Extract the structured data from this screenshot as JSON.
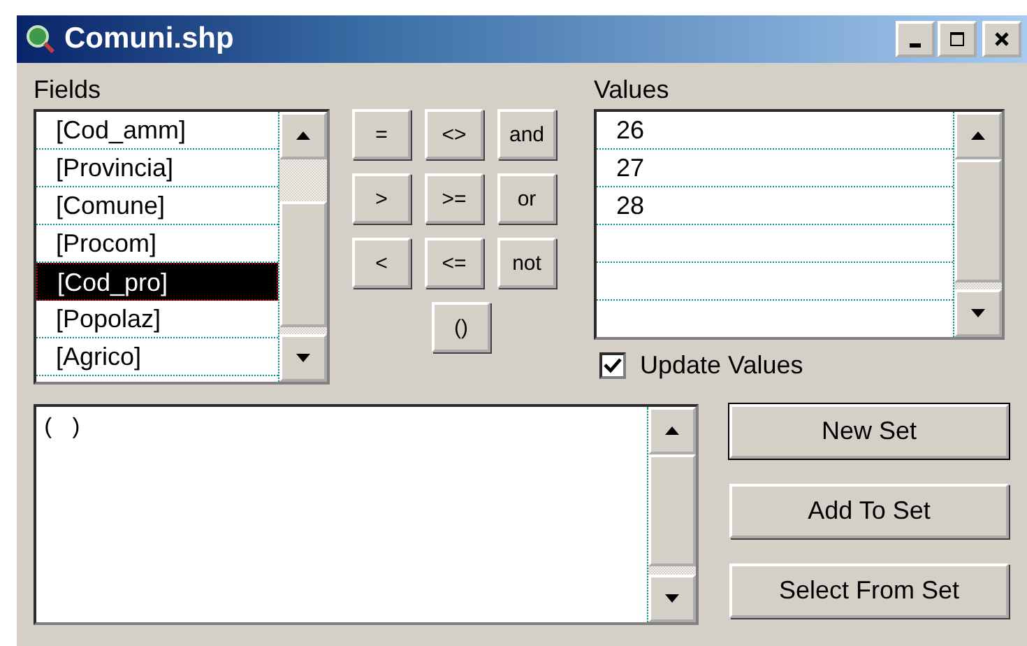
{
  "window": {
    "title": "Comuni.shp"
  },
  "fields": {
    "label": "Fields",
    "items": [
      {
        "label": "[Cod_amm]",
        "selected": false
      },
      {
        "label": "[Provincia]",
        "selected": false
      },
      {
        "label": "[Comune]",
        "selected": false
      },
      {
        "label": "[Procom]",
        "selected": false
      },
      {
        "label": "[Cod_pro]",
        "selected": true
      },
      {
        "label": "[Popolaz]",
        "selected": false
      },
      {
        "label": "[Agrico]",
        "selected": false
      }
    ]
  },
  "operators": [
    [
      "=",
      "<>",
      "and"
    ],
    [
      ">",
      ">=",
      "or"
    ],
    [
      "<",
      "<=",
      "not"
    ],
    [
      "()"
    ]
  ],
  "values": {
    "label": "Values",
    "items": [
      "26",
      "27",
      "28"
    ]
  },
  "update_values": {
    "label": "Update Values",
    "checked": true
  },
  "expression": {
    "value": "( )"
  },
  "buttons": [
    "New Set",
    "Add To Set",
    "Select From Set"
  ]
}
